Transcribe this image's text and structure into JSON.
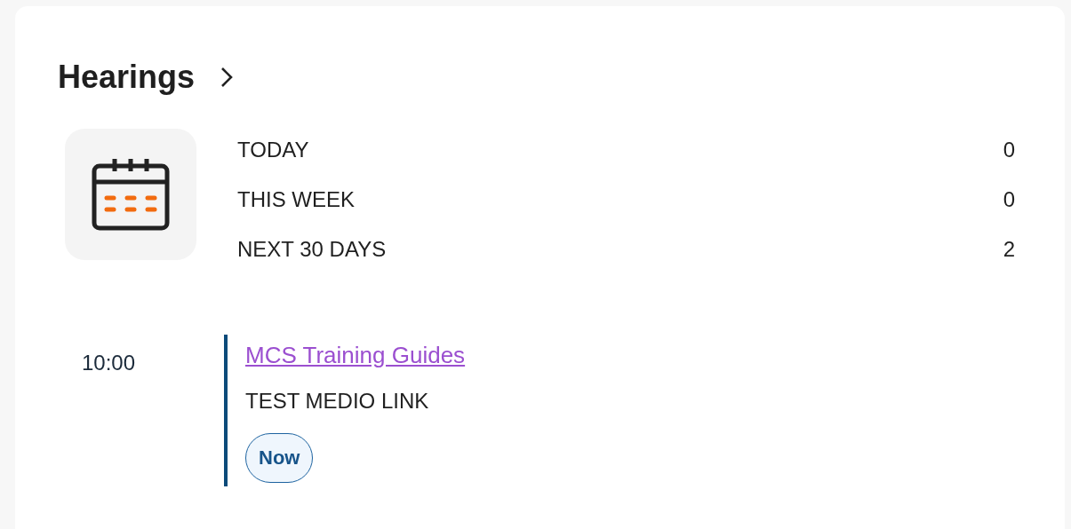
{
  "card": {
    "title": "Hearings"
  },
  "stats": [
    {
      "label": "TODAY",
      "value": "0"
    },
    {
      "label": "THIS WEEK",
      "value": "0"
    },
    {
      "label": "NEXT 30 DAYS",
      "value": "2"
    }
  ],
  "events": [
    {
      "time": "10:00",
      "title": "MCS Training Guides",
      "subtitle": "TEST MEDIO LINK",
      "badge": "Now"
    }
  ]
}
